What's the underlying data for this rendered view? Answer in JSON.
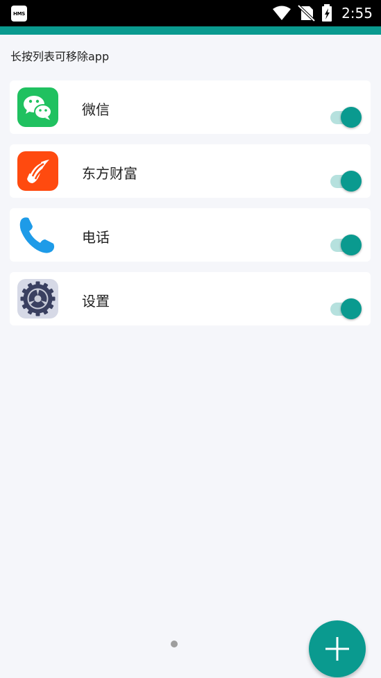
{
  "status_bar": {
    "notification_badge": "HMS",
    "time": "2:55",
    "icons": [
      "wifi-icon",
      "no-sim-icon",
      "battery-charging-icon"
    ]
  },
  "header": {
    "hint": "长按列表可移除app"
  },
  "apps": [
    {
      "label": "微信",
      "icon": "wechat-icon",
      "color": "#20c160",
      "enabled": true
    },
    {
      "label": "东方财富",
      "icon": "eastmoney-icon",
      "color": "#ff4a0f",
      "enabled": true
    },
    {
      "label": "电话",
      "icon": "phone-icon",
      "color": "#1e9be8",
      "enabled": true
    },
    {
      "label": "设置",
      "icon": "settings-gear-icon",
      "color": "#3a4060",
      "enabled": true
    }
  ],
  "colors": {
    "accent": "#0a9a8f",
    "toggle_track": "#b6e1de",
    "background": "#f5f6fa"
  },
  "fab": {
    "icon": "plus-icon"
  }
}
